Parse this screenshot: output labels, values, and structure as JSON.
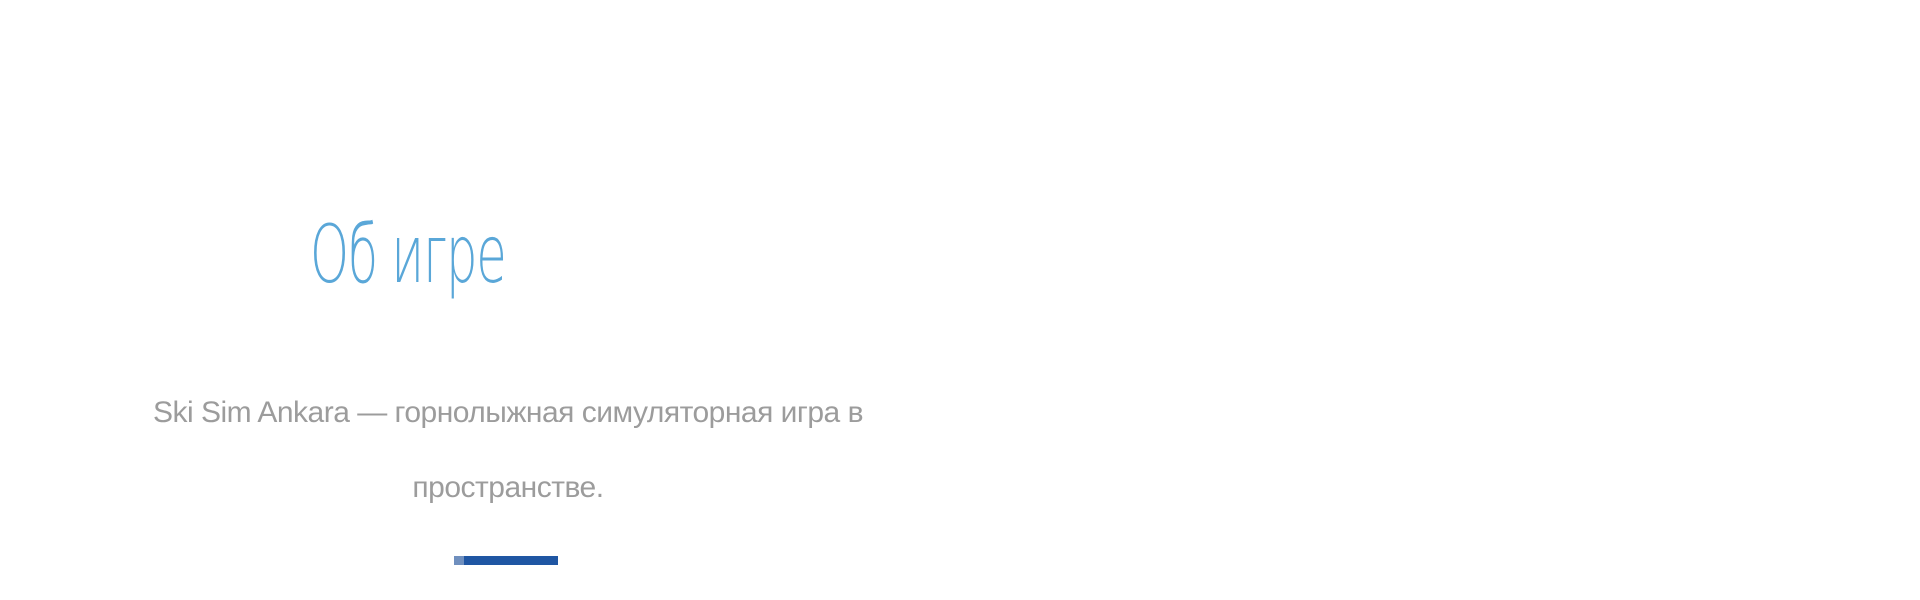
{
  "about": {
    "title": "Об игре",
    "description": "Ski Sim Ankara — горнолыжная симуляторная игра в пространстве.",
    "accent_color": "#5aa7d8",
    "underline_color": "#1f56a3"
  }
}
